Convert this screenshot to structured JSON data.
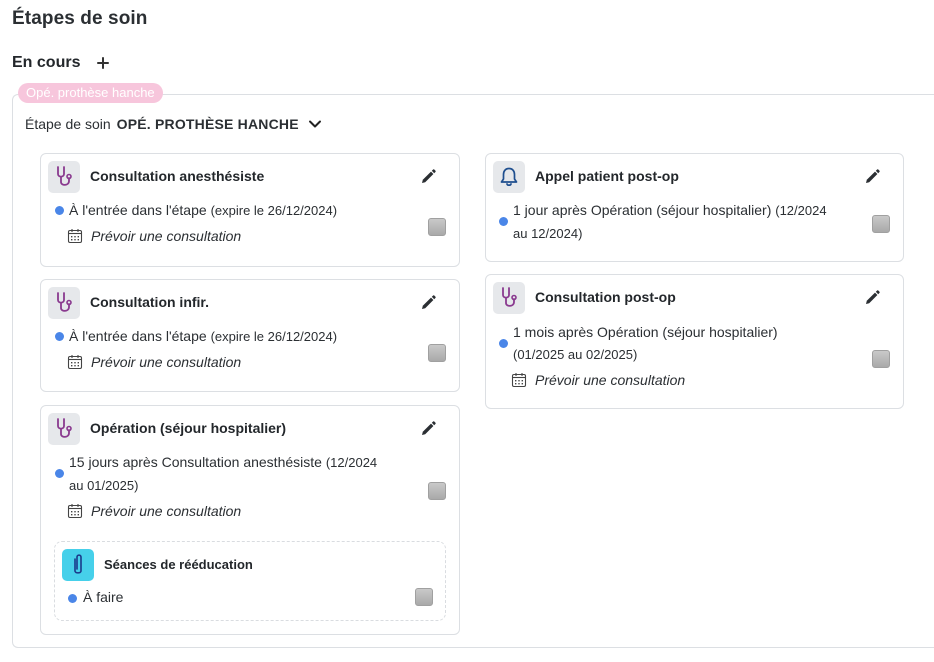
{
  "page_title": "Étapes de soin",
  "section": {
    "title": "En cours"
  },
  "group": {
    "tag": "Opé. prothèse hanche",
    "etape_label": "Étape de soin",
    "etape_value": "OPÉ. PROTHÈSE HANCHE"
  },
  "colors": {
    "accent_dot": "#4a86e8",
    "tag_bg": "#f7c6dc",
    "stethoscope": "#8a3a8f",
    "rehab_tile": "#46d0ea"
  },
  "cards": {
    "c1": {
      "icon": "stethoscope-icon",
      "title": "Consultation anesthésiste",
      "timing": "À l'entrée dans l'étape",
      "timing_note": "(expire le 26/12/2024)",
      "action": "Prévoir une consultation"
    },
    "c2": {
      "icon": "stethoscope-icon",
      "title": "Consultation infir.",
      "timing": "À l'entrée dans l'étape",
      "timing_note": "(expire le 26/12/2024)",
      "action": "Prévoir une consultation"
    },
    "c3": {
      "icon": "stethoscope-icon",
      "title": "Opération (séjour hospitalier)",
      "timing": "15 jours après Consultation anesthésiste",
      "timing_note": "(12/2024",
      "timing_note2": "au 01/2025)",
      "action": "Prévoir une consultation",
      "sub": {
        "icon": "clip-icon",
        "title": "Séances de rééducation",
        "status": "À faire"
      }
    },
    "c4": {
      "icon": "bell-icon",
      "title": "Appel patient post-op",
      "timing": "1 jour après Opération (séjour hospitalier)",
      "timing_note": "(12/2024",
      "timing_note2": "au 12/2024)"
    },
    "c5": {
      "icon": "stethoscope-icon",
      "title": "Consultation post-op",
      "timing": "1 mois après Opération (séjour hospitalier)",
      "timing_note": "(01/2025 au 02/2025)",
      "action": "Prévoir une consultation"
    }
  }
}
